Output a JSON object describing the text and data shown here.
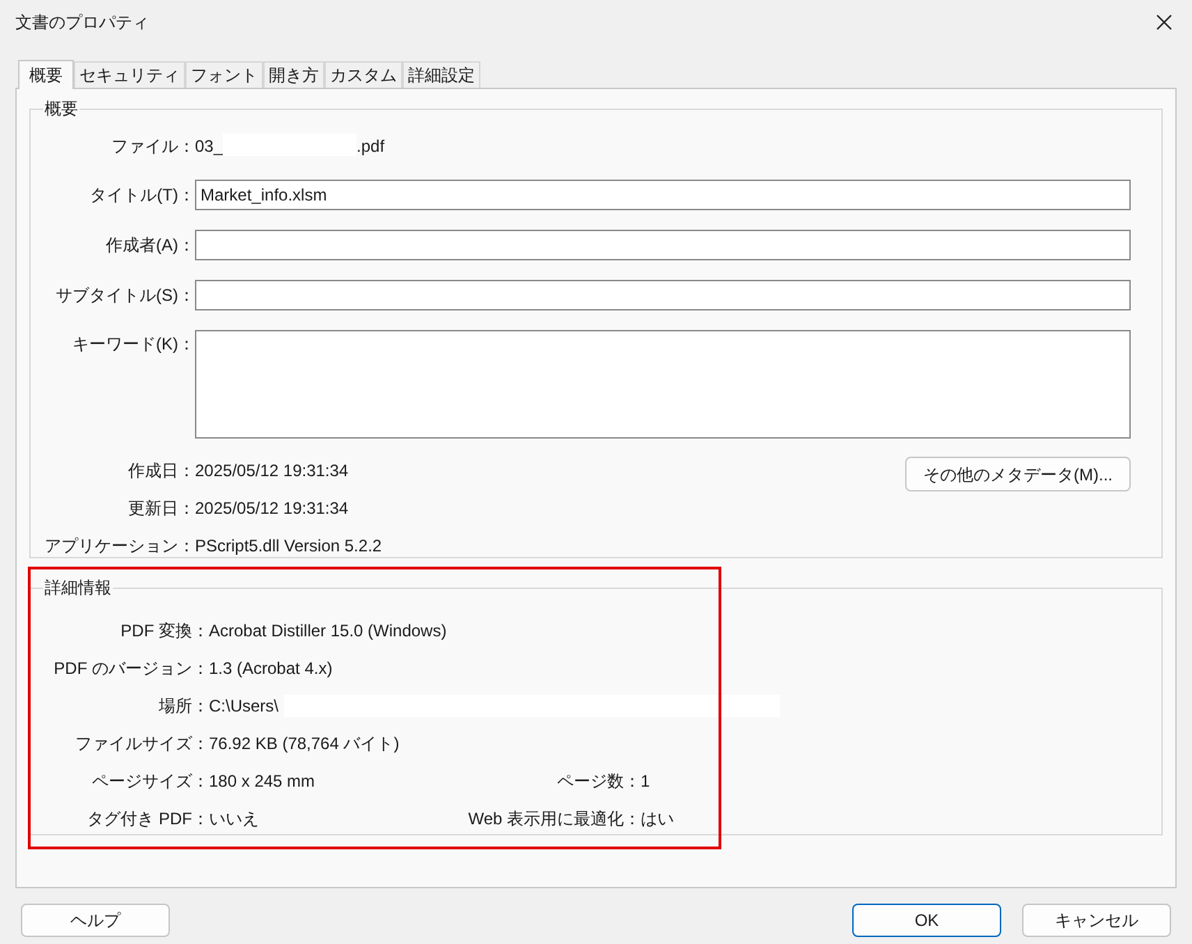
{
  "window": {
    "title": "文書のプロパティ"
  },
  "tabs": [
    {
      "label": "概要",
      "selected": true
    },
    {
      "label": "セキュリティ",
      "selected": false
    },
    {
      "label": "フォント",
      "selected": false
    },
    {
      "label": "開き方",
      "selected": false
    },
    {
      "label": "カスタム",
      "selected": false
    },
    {
      "label": "詳細設定",
      "selected": false
    }
  ],
  "summary": {
    "legend": "概要",
    "file": {
      "label": "ファイル：",
      "prefix": "03_",
      "suffix": ".pdf"
    },
    "fields": [
      {
        "label": "タイトル(T)：",
        "value": "Market_info.xlsm",
        "kind": "line"
      },
      {
        "label": "作成者(A)：",
        "kind": "line"
      },
      {
        "label": "サブタイトル(S)：",
        "kind": "line"
      },
      {
        "label": "キーワード(K)：",
        "kind": "area"
      }
    ],
    "dates": [
      {
        "label": "作成日：",
        "value": "2025/05/12 19:31:34"
      },
      {
        "label": "更新日：",
        "value": "2025/05/12 19:31:34"
      },
      {
        "label": "アプリケーション：",
        "value": "PScript5.dll Version 5.2.2"
      }
    ],
    "metadata_button": "その他のメタデータ(M)..."
  },
  "details": {
    "legend": "詳細情報",
    "highlighted": true,
    "rows": [
      {
        "label": "PDF 変換：",
        "value": "Acrobat Distiller 15.0 (Windows)"
      },
      {
        "label": "PDF のバージョン：",
        "value": "1.3 (Acrobat 4.x)"
      },
      {
        "label": "場所：",
        "value": "C:\\Users\\",
        "redacted": true
      },
      {
        "label": "ファイルサイズ：",
        "value": "76.92 KB (78,764 バイト)"
      },
      {
        "label": "ページサイズ：",
        "value": "180 x 245 mm",
        "label_2": "ページ数：",
        "value_2": "1"
      },
      {
        "label": "タグ付き PDF：",
        "value": "いいえ",
        "label_2": "Web 表示用に最適化：",
        "value_2": "はい"
      }
    ]
  },
  "buttons": {
    "help": "ヘルプ",
    "ok": "OK",
    "cancel": "キャンセル"
  }
}
